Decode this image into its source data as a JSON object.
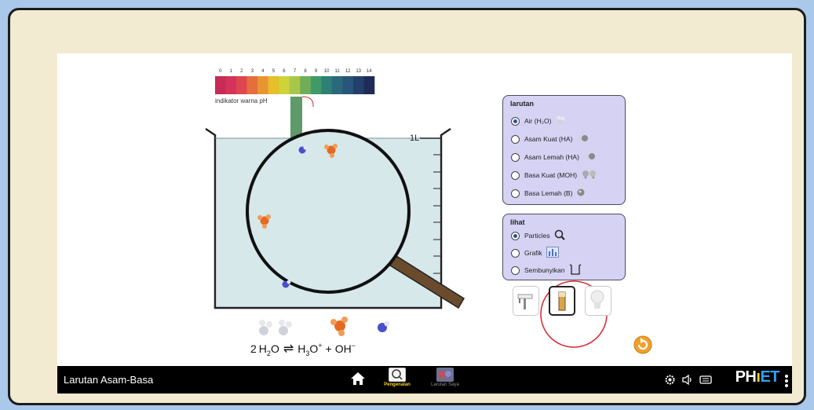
{
  "app": {
    "title": "Larutan Asam-Basa"
  },
  "indicator": {
    "scale": [
      "0",
      "1",
      "2",
      "3",
      "4",
      "5",
      "6",
      "7",
      "8",
      "9",
      "10",
      "11",
      "12",
      "13",
      "14"
    ],
    "label": "indikator warna pH",
    "colors": [
      "#c62a55",
      "#d4335a",
      "#de4650",
      "#e46f3c",
      "#e99432",
      "#e6bf2b",
      "#cfd33a",
      "#a8c74a",
      "#6fae57",
      "#3f9a67",
      "#2e7f74",
      "#29697a",
      "#27567a",
      "#253f6c",
      "#1f2c58"
    ]
  },
  "beaker": {
    "volume_label": "1L"
  },
  "equation": {
    "lhs_coef": "2",
    "lhs_main": "H",
    "lhs_sub": "2",
    "lhs_tail": "O",
    "arrows": "⇌",
    "p1_main": "H",
    "p1_sub": "3",
    "p1_tail": "O",
    "p1_sup": "+",
    "plus": "+",
    "p2": "OH",
    "p2_sup": "−"
  },
  "solution_panel": {
    "title": "larutan",
    "options": [
      {
        "label": "Air (H₂O)",
        "selected": true,
        "icon": "water-molecule-icon"
      },
      {
        "label": "Asam Kuat (HA)",
        "selected": false,
        "icon": "strong-acid-molecule-icon"
      },
      {
        "label": "Asam Lemah (HA)",
        "selected": false,
        "icon": "weak-acid-molecule-icon"
      },
      {
        "label": "Basa Kuat (MOH)",
        "selected": false,
        "icon": "strong-base-molecule-icon"
      },
      {
        "label": "Basa Lemah (B)",
        "selected": false,
        "icon": "weak-base-molecule-icon"
      }
    ]
  },
  "view_panel": {
    "title": "lihat",
    "options": [
      {
        "label": "Particles",
        "selected": true,
        "icon": "magnifier-icon"
      },
      {
        "label": "Grafik",
        "selected": false,
        "icon": "bar-graph-icon"
      },
      {
        "label": "Sembunyikan",
        "selected": false,
        "icon": "empty-beaker-icon"
      }
    ]
  },
  "tools": [
    {
      "name": "ph-meter",
      "selected": false
    },
    {
      "name": "ph-paper",
      "selected": true
    },
    {
      "name": "conductivity-tester",
      "selected": false
    }
  ],
  "navbar": {
    "screens": [
      {
        "label": "Pengenalan",
        "selected": true
      },
      {
        "label": "Larutan Saya",
        "selected": false
      }
    ],
    "logo": {
      "ph": "PH",
      "i": "ı",
      "et": "ET"
    }
  },
  "colors": {
    "panel_bg": "#d6d2f4",
    "water": "#d6e8ea",
    "accent_orange": "#f1a12a",
    "highlight_ring": "#d9272e",
    "frame_bg": "#f2ebd1",
    "outer_bg": "#a9c8ea"
  }
}
